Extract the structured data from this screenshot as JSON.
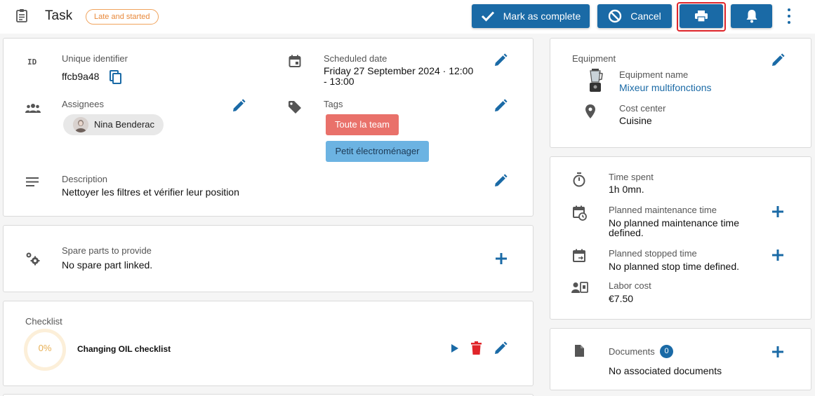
{
  "header": {
    "title": "Task",
    "status_badge": "Late and started",
    "mark_complete_label": "Mark as complete",
    "cancel_label": "Cancel"
  },
  "details": {
    "id_icon_text": "ID",
    "id_label": "Unique identifier",
    "id_value": "ffcb9a48",
    "scheduled_label": "Scheduled date",
    "scheduled_line1": "Friday 27 September 2024 · 12:00",
    "scheduled_line2": "- 13:00",
    "assignees_label": "Assignees",
    "assignee_name": "Nina Benderac",
    "tags_label": "Tags",
    "tags": [
      "Toute la team",
      "Petit électroménager"
    ],
    "description_label": "Description",
    "description_value": "Nettoyer les filtres et vérifier leur position"
  },
  "spare_parts": {
    "label": "Spare parts to provide",
    "value": "No spare part linked."
  },
  "checklist": {
    "title": "Checklist",
    "progress_percent": 0,
    "progress_text": "0%",
    "item_name": "Changing OIL checklist"
  },
  "equipment": {
    "title": "Equipment",
    "name_label": "Equipment name",
    "name_value": "Mixeur multifonctions",
    "cost_center_label": "Cost center",
    "cost_center_value": "Cuisine"
  },
  "time": {
    "spent_label": "Time spent",
    "spent_value": "1h 0mn.",
    "planned_maint_label": "Planned maintenance time",
    "planned_maint_line1": "No planned maintenance time",
    "planned_maint_line2": "defined.",
    "planned_stop_label": "Planned stopped time",
    "planned_stop_value": "No planned stop time defined.",
    "labor_label": "Labor cost",
    "labor_value": "€7.50"
  },
  "documents": {
    "label": "Documents",
    "count": "0",
    "value": "No associated documents"
  },
  "colors": {
    "primary": "#1a6aa6",
    "badge_orange": "#e8893b",
    "tag_team": "#e9716a",
    "tag_elec": "#6cb3e2",
    "delete_red": "#e0252a",
    "highlight_red": "#e0252a"
  },
  "icons": [
    "clipboard-icon",
    "check-icon",
    "cancel-icon",
    "print-icon",
    "bell-icon",
    "more-vert-icon",
    "calendar-icon",
    "people-icon",
    "tag-icon",
    "description-icon",
    "gears-icon",
    "copy-icon",
    "edit-icon",
    "plus-icon",
    "play-icon",
    "trash-icon",
    "blender-icon",
    "location-icon",
    "timer-icon",
    "calendar-clock-icon",
    "calendar-stop-icon",
    "labor-cost-icon",
    "document-icon"
  ]
}
